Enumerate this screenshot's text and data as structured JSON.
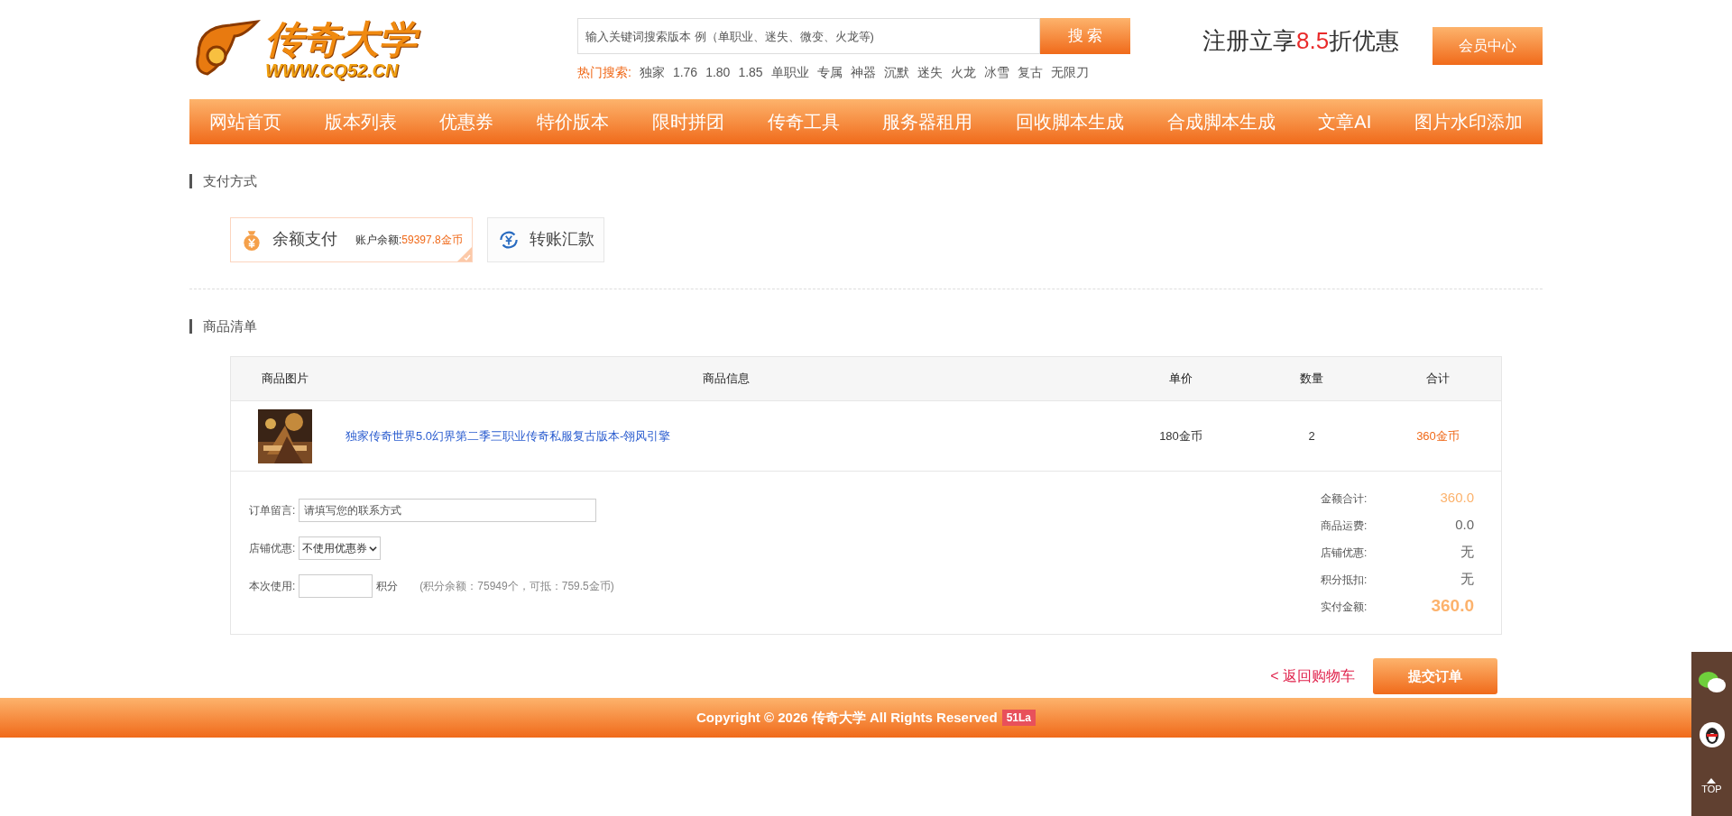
{
  "logo": {
    "title": "传奇大学",
    "url": "WWW.CQ52.CN"
  },
  "search": {
    "placeholder": "输入关键词搜索版本 例（单职业、迷失、微变、火龙等)",
    "button": "搜 索",
    "hot_label": "热门搜索:",
    "hot": [
      "独家",
      "1.76",
      "1.80",
      "1.85",
      "单职业",
      "专属",
      "神器",
      "沉默",
      "迷失",
      "火龙",
      "冰雪",
      "复古",
      "无限刀"
    ]
  },
  "promo": {
    "before": "注册立享",
    "rate": "8.5",
    "after": "折优惠"
  },
  "member_button": "会员中心",
  "nav": [
    "网站首页",
    "版本列表",
    "优惠券",
    "特价版本",
    "限时拼团",
    "传奇工具",
    "服务器租用",
    "回收脚本生成",
    "合成脚本生成",
    "文章AI",
    "图片水印添加"
  ],
  "payment": {
    "title": "支付方式",
    "methods": [
      {
        "kind": "balance",
        "label": "余额支付",
        "balance_label": "账户余额:",
        "balance": "59397.8金币",
        "selected": true
      },
      {
        "kind": "transfer",
        "label": "转账汇款",
        "selected": false
      }
    ]
  },
  "goods": {
    "title": "商品清单",
    "columns": [
      "商品图片",
      "商品信息",
      "单价",
      "数量",
      "合计"
    ],
    "rows": [
      {
        "name": "独家传奇世界5.0幻界第二季三职业传奇私服复古版本-翎风引擎",
        "price": "180金币",
        "qty": "2",
        "total": "360金币"
      }
    ]
  },
  "order_form": {
    "note_label": "订单留言:",
    "note_placeholder": "请填写您的联系方式",
    "coupon_label": "店铺优惠:",
    "coupon_value": "不使用优惠券",
    "points_label": "本次使用:",
    "points_unit": "积分",
    "points_hint": "(积分余额：75949个，可抵：759.5金币)"
  },
  "summary": [
    {
      "kind": "total",
      "label": "金额合计:",
      "value": "360.0"
    },
    {
      "kind": "plain",
      "label": "商品运费:",
      "value": "0.0"
    },
    {
      "kind": "plain",
      "label": "店铺优惠:",
      "value": "无"
    },
    {
      "kind": "plain",
      "label": "积分抵扣:",
      "value": "无"
    },
    {
      "kind": "pay",
      "label": "实付金额:",
      "value": "360.0"
    }
  ],
  "back_link": "< 返回购物车",
  "submit": "提交订单",
  "footer": {
    "text": "Copyright © 2026 传奇大学 All Rights Reserved",
    "badge": "51La"
  },
  "side": {
    "top": "TOP"
  }
}
